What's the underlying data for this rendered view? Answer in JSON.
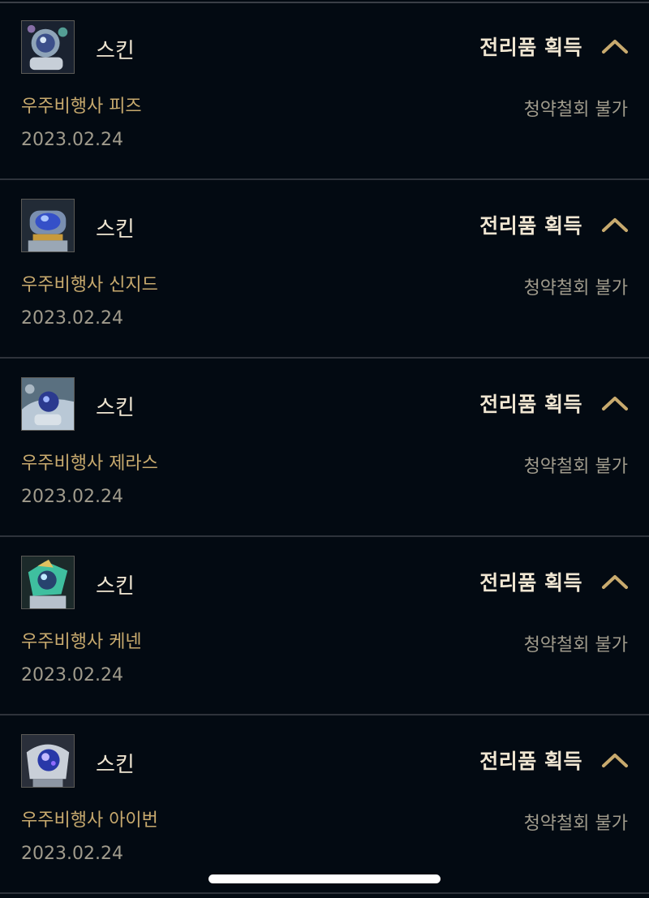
{
  "colors": {
    "background": "#030a12",
    "gold": "#c8aa6e",
    "text_light": "#f0e6d2",
    "text_muted": "#a09b8c",
    "divider": "#2e333b"
  },
  "items": [
    {
      "thumbnail_icon": "astronaut-skin-thumbnail",
      "type": "스킨",
      "source": "전리품 획득",
      "name": "우주비행사 피즈",
      "refund_status": "청약철회 불가",
      "date": "2023.02.24"
    },
    {
      "thumbnail_icon": "astronaut-skin-thumbnail",
      "type": "스킨",
      "source": "전리품 획득",
      "name": "우주비행사 신지드",
      "refund_status": "청약철회 불가",
      "date": "2023.02.24"
    },
    {
      "thumbnail_icon": "astronaut-skin-thumbnail",
      "type": "스킨",
      "source": "전리품 획득",
      "name": "우주비행사 제라스",
      "refund_status": "청약철회 불가",
      "date": "2023.02.24"
    },
    {
      "thumbnail_icon": "astronaut-skin-thumbnail",
      "type": "스킨",
      "source": "전리품 획득",
      "name": "우주비행사 케넨",
      "refund_status": "청약철회 불가",
      "date": "2023.02.24"
    },
    {
      "thumbnail_icon": "astronaut-skin-thumbnail",
      "type": "스킨",
      "source": "전리품 획득",
      "name": "우주비행사 아이번",
      "refund_status": "청약철회 불가",
      "date": "2023.02.24"
    }
  ]
}
